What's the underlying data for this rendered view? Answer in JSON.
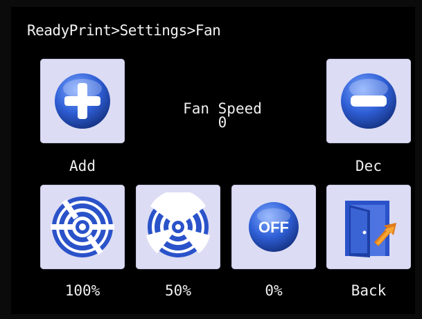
{
  "breadcrumb": "ReadyPrint>Settings>Fan",
  "fan": {
    "title": "Fan Speed",
    "value": "0"
  },
  "buttons": {
    "add": {
      "label": "Add",
      "icon": "plus-icon"
    },
    "dec": {
      "label": "Dec",
      "icon": "minus-icon"
    },
    "full": {
      "label": "100%",
      "icon": "fan-full-icon"
    },
    "half": {
      "label": "50%",
      "icon": "fan-half-icon"
    },
    "off": {
      "label": "0%",
      "icon": "off-icon",
      "icon_text": "OFF"
    },
    "back": {
      "label": "Back",
      "icon": "exit-door-icon"
    }
  },
  "colors": {
    "tile": "#dcdcf4",
    "icon_blue": "#2a52c9",
    "background": "#000000"
  }
}
